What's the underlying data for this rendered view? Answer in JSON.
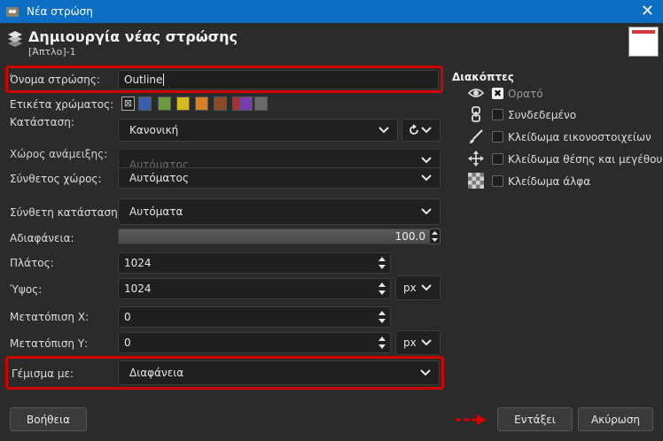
{
  "window": {
    "title": "Νέα στρώση"
  },
  "header": {
    "title": "Δημιουργία νέας στρώσης",
    "subtitle": "[Άπτλο]-1"
  },
  "form": {
    "layer_name": {
      "label": "Όνομα στρώσης:",
      "value": "Outline"
    },
    "color_tag": {
      "label": "Ετικέτα χρώματος:",
      "colors": [
        "none",
        "#3b5fb0",
        "#6a9a3a",
        "#d6b81f",
        "#d97f1f",
        "#8a4b2a",
        "#b52a2a",
        "#7a3ab5",
        "#6a6a6a"
      ]
    },
    "mode": {
      "label": "Κατάσταση:",
      "value": "Κανονική"
    },
    "blend_space": {
      "label": "Χώρος ανάμειξης:",
      "value": "Αυτόματος"
    },
    "composite_space": {
      "label": "Σύνθετος χώρος:",
      "value": "Αυτόματος"
    },
    "composite_mode": {
      "label": "Σύνθετη κατάσταση:",
      "value": "Αυτόματα"
    },
    "opacity": {
      "label": "Αδιαφάνεια:",
      "value": "100.0",
      "fraction": 1.0
    },
    "width": {
      "label": "Πλάτος:",
      "value": "1024"
    },
    "height": {
      "label": "Ύψος:",
      "value": "1024",
      "unit": "px"
    },
    "offset_x": {
      "label": "Μετατόπιση Χ:",
      "value": "0"
    },
    "offset_y": {
      "label": "Μετατόπιση Υ:",
      "value": "0",
      "unit": "px"
    },
    "fill": {
      "label": "Γέμισμα με:",
      "value": "Διαφάνεια"
    }
  },
  "switches": {
    "title": "Διακόπτες",
    "items": [
      {
        "label": "Ορατό",
        "icon": "eye-icon",
        "checked": true
      },
      {
        "label": "Συνδεδεμένο",
        "icon": "chain-icon",
        "checked": false
      },
      {
        "label": "Κλείδωμα εικονοστοιχείων",
        "icon": "brush-icon",
        "checked": false
      },
      {
        "label": "Κλείδωμα θέσης και μεγέθους",
        "icon": "move-icon",
        "checked": false
      },
      {
        "label": "Κλείδωμα άλφα",
        "icon": "checker-icon",
        "checked": false
      }
    ]
  },
  "buttons": {
    "help": "Βοήθεια",
    "ok": "Εντάξει",
    "cancel": "Ακύρωση"
  },
  "colors": {
    "titlebar": "#0d6ec4",
    "highlight": "#d40000",
    "background": "#2b2b2b"
  }
}
